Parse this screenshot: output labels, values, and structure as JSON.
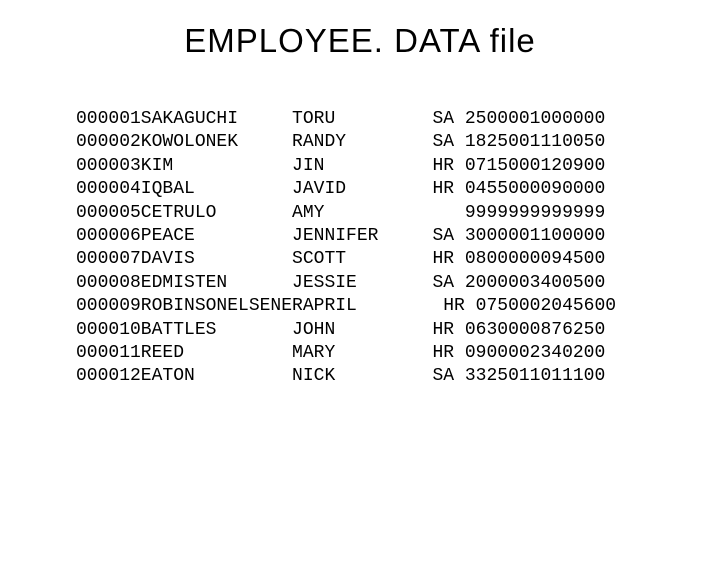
{
  "title": "EMPLOYEE. DATA file",
  "columns": {
    "id_width": 6,
    "last_width": 14,
    "first_width": 13,
    "rest_width": 17
  },
  "records": [
    {
      "id": "000001",
      "last": "SAKAGUCHI",
      "first": "TORU",
      "rest": "SA 2500001000000"
    },
    {
      "id": "000002",
      "last": "KOWOLONEK",
      "first": "RANDY",
      "rest": "SA 1825001110050"
    },
    {
      "id": "000003",
      "last": "KIM",
      "first": "JIN",
      "rest": "HR 0715000120900"
    },
    {
      "id": "000004",
      "last": "IQBAL",
      "first": "JAVID",
      "rest": "HR 0455000090000"
    },
    {
      "id": "000005",
      "last": "CETRULO",
      "first": "AMY",
      "rest": "   9999999999999"
    },
    {
      "id": "000006",
      "last": "PEACE",
      "first": "JENNIFER",
      "rest": "SA 3000001100000"
    },
    {
      "id": "000007",
      "last": "DAVIS",
      "first": "SCOTT",
      "rest": "HR 0800000094500"
    },
    {
      "id": "000008",
      "last": "EDMISTEN",
      "first": "JESSIE",
      "rest": "SA 2000003400500"
    },
    {
      "id": "000009",
      "last": "ROBINSONELSENER",
      "first": "APRIL",
      "rest": "HR 0750002045600"
    },
    {
      "id": "000010",
      "last": "BATTLES",
      "first": "JOHN",
      "rest": "HR 0630000876250"
    },
    {
      "id": "000011",
      "last": "REED",
      "first": "MARY",
      "rest": "HR 0900002340200"
    },
    {
      "id": "000012",
      "last": "EATON",
      "first": "NICK",
      "rest": "SA 3325011011100"
    }
  ]
}
